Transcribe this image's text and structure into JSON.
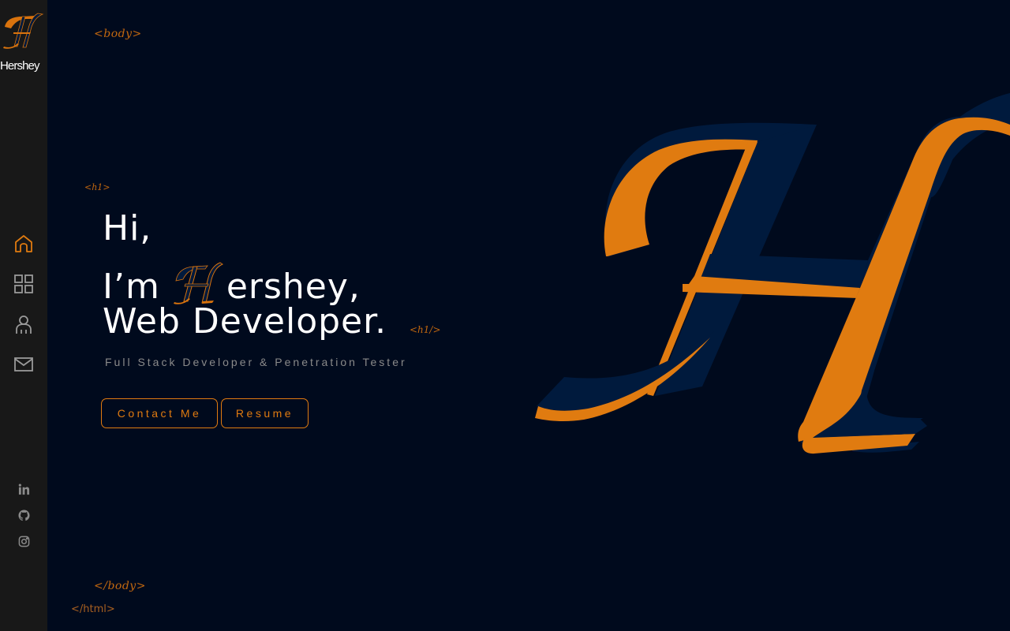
{
  "brand": {
    "name": "Hershey",
    "colors": {
      "accent": "#e07b10",
      "navy": "#001a3d",
      "background": "#000a1d",
      "sidebar": "#181818"
    }
  },
  "sidebar": {
    "nav": [
      {
        "id": "home",
        "icon": "home-icon",
        "active": true
      },
      {
        "id": "portfolio",
        "icon": "grid-icon",
        "active": false
      },
      {
        "id": "about",
        "icon": "user-icon",
        "active": false
      },
      {
        "id": "contact",
        "icon": "mail-icon",
        "active": false
      }
    ],
    "social": [
      {
        "id": "linkedin",
        "icon": "linkedin-icon"
      },
      {
        "id": "github",
        "icon": "github-icon"
      },
      {
        "id": "instagram",
        "icon": "instagram-icon"
      }
    ]
  },
  "tags": {
    "body_open": "<body>",
    "h1_open": "<h1>",
    "h1_close": "<h1/>",
    "body_close": "</body>",
    "html_close": "</html>"
  },
  "hero": {
    "line1": "Hi,",
    "line2_prefix": "I’m",
    "line2_suffix": "ershey,",
    "line3": "Web Developer.",
    "subtitle": "Full Stack Developer & Penetration Tester",
    "contact_button": "Contact Me",
    "resume_button": "Resume"
  }
}
